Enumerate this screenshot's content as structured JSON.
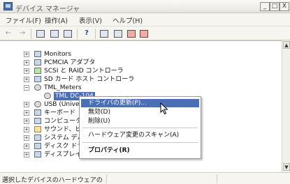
{
  "window": {
    "title": "デバイス マネージャ",
    "minimize": "_",
    "maximize": "□",
    "close": "X"
  },
  "menubar": {
    "items": [
      "ファイル(F)",
      "操作(A)",
      "表示(V)",
      "ヘルプ(H)"
    ]
  },
  "toolbar": {
    "back": "←",
    "forward": "→",
    "help": "?"
  },
  "tree": {
    "rows": [
      {
        "label": "Monitors",
        "expander": "+"
      },
      {
        "label": "PCMCIA アダプタ",
        "expander": "+"
      },
      {
        "label": "SCSI と RAID コントローラ",
        "expander": "+"
      },
      {
        "label": "SD カード ホスト コントローラ",
        "expander": "+"
      },
      {
        "label": "TML_Meters",
        "expander": "−"
      },
      {
        "label": "TML DC-104"
      },
      {
        "label": "USB (Universal S",
        "expander": "+"
      },
      {
        "label": "キーボード",
        "expander": "+"
      },
      {
        "label": "コンピュータ",
        "expander": "+"
      },
      {
        "label": "サウンド、ビデオ、お",
        "expander": "+"
      },
      {
        "label": "システム デバイス",
        "expander": "+"
      },
      {
        "label": "ディスク ドライブ",
        "expander": "+"
      },
      {
        "label": "ディスプレイ アダプタ",
        "expander": "+"
      }
    ]
  },
  "context_menu": {
    "items": [
      {
        "label": "ドライバの更新(P)..."
      },
      {
        "label": "無効(D)"
      },
      {
        "label": "削除(U)"
      },
      {
        "label": "ハードウェア変更のスキャン(A)"
      },
      {
        "label": "プロパティ(R)"
      }
    ]
  },
  "status": {
    "text": "選択したデバイスのハードウェアの"
  },
  "scrollbar": {
    "up": "▲",
    "down": "▼"
  }
}
